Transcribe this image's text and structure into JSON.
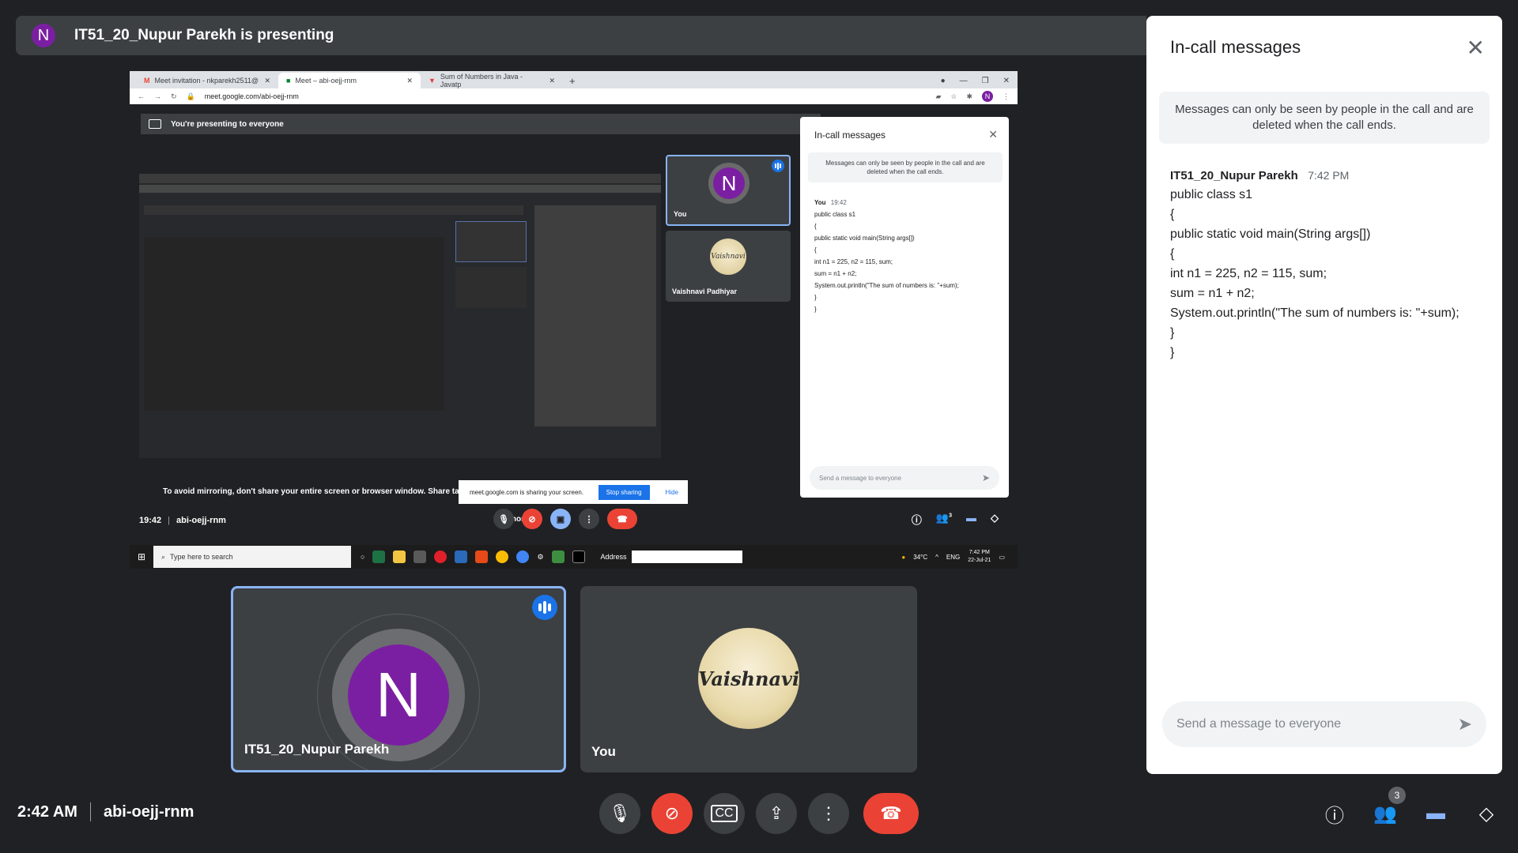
{
  "presenting_bar": {
    "avatar_letter": "N",
    "text": "IT51_20_Nupur Parekh is presenting"
  },
  "shared_screen": {
    "browser": {
      "tabs": [
        {
          "label": "Meet invitation - nkparekh2511@",
          "icon": "gmail-icon"
        },
        {
          "label": "Meet – abi-oejj-rnm",
          "icon": "meet-icon"
        },
        {
          "label": "Sum of Numbers in Java - Javatp",
          "icon": "javatpoint-icon"
        }
      ],
      "url": "meet.google.com/abi-oejj-rnm",
      "profile_letter": "N"
    },
    "banner": "You're presenting to everyone",
    "tiles": {
      "you": {
        "letter": "N",
        "name": "You"
      },
      "vaishnavi": {
        "logo": "Vaishnavi",
        "name": "Vaishnavi Padhiyar"
      }
    },
    "inner_chat": {
      "title": "In-call messages",
      "note": "Messages can only be seen by people in the call and are deleted when the call ends.",
      "sender": "You",
      "time": "19:42",
      "lines": [
        "public class s1",
        "{",
        "public static void main(String args[])",
        "{",
        "int n1 = 225, n2 = 115, sum;",
        "sum = n1 + n2;",
        "System.out.println(\"The sum of numbers is: \"+sum);",
        "}",
        "}"
      ],
      "input_placeholder": "Send a message to everyone"
    },
    "mirror_warning": "To avoid mirroring, don't share your entire screen or browser window. Share tab or a different window instead.",
    "share_popup": {
      "text": "meet.google.com is sharing your screen.",
      "stop": "Stop sharing",
      "hide": "Hide"
    },
    "ignore": "Ignore",
    "bottom": {
      "time": "19:42",
      "code": "abi-oejj-rnm",
      "people_count": "3"
    },
    "taskbar": {
      "search_placeholder": "Type here to search",
      "address_label": "Address",
      "temperature": "34°C",
      "lang": "ENG",
      "clock_time": "7:42 PM",
      "clock_date": "22-Jul-21"
    }
  },
  "tiles": {
    "nupur": {
      "letter": "N",
      "name": "IT51_20_Nupur Parekh"
    },
    "you": {
      "logo": "Vaishnavi",
      "name": "You"
    }
  },
  "chat": {
    "title": "In-call messages",
    "note": "Messages can only be seen by people in the call and are deleted when the call ends.",
    "sender": "IT51_20_Nupur Parekh",
    "time": "7:42 PM",
    "lines": [
      "public class s1",
      "{",
      "public static void main(String args[])",
      "{",
      "int n1 = 225, n2 = 115, sum;",
      "sum = n1 + n2;",
      "System.out.println(\"The sum of numbers is: \"+sum);",
      "}",
      "}"
    ],
    "input_placeholder": "Send a message to everyone"
  },
  "bottom_bar": {
    "time": "2:42 AM",
    "meeting_code": "abi-oejj-rnm",
    "people_count": "3"
  },
  "colors": {
    "background": "#202124",
    "tile": "#3c4043",
    "accent_blue": "#8ab4f8",
    "end_call_red": "#ea4335",
    "avatar_purple": "#7b1fa2"
  }
}
